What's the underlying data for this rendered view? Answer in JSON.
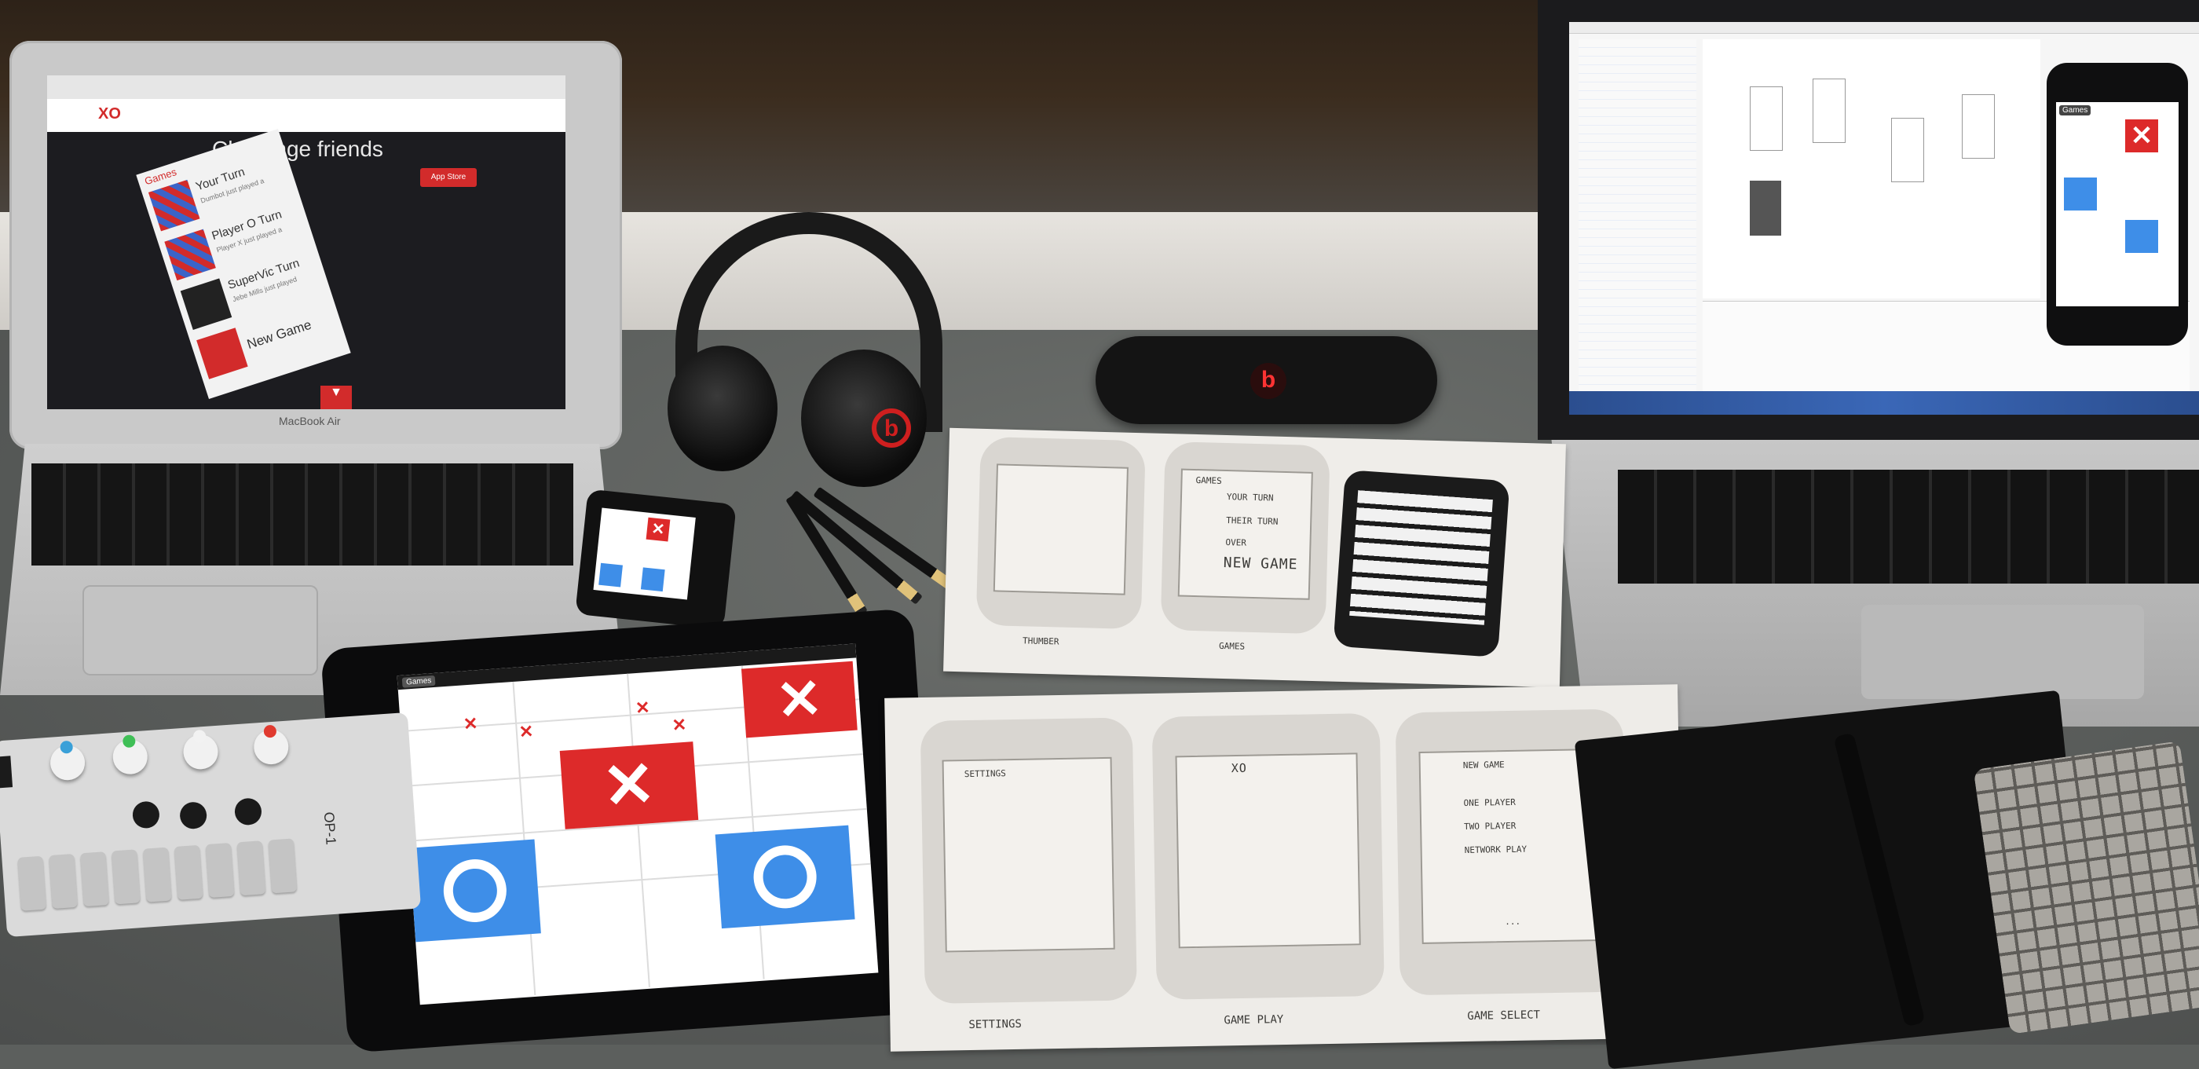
{
  "macbook_air": {
    "brand": "MacBook Air",
    "site": {
      "logo": "XO",
      "headline": "Challenge friends",
      "card_header": "Games",
      "rows": [
        {
          "title": "Your Turn",
          "subtitle": "Dumbot just played a"
        },
        {
          "title": "Player O Turn",
          "subtitle": "Player X just played a"
        },
        {
          "title": "SuperVic Turn",
          "subtitle": "Jebe Mills just played"
        },
        {
          "title": "New Game",
          "subtitle": ""
        }
      ],
      "app_store_badge": "App Store",
      "scroll_arrow": "▼"
    }
  },
  "macbook_pro": {
    "phone_games_button": "Games"
  },
  "ipad": {
    "games_button": "Games"
  },
  "sketch_sheet_top": {
    "labels": [
      "THUMBER",
      "GAMES"
    ],
    "games_screen_items": [
      "GAMES",
      "YOUR TURN",
      "THEIR TURN",
      "OVER",
      "NEW GAME"
    ]
  },
  "sketch_sheet_bottom": {
    "screens": [
      "SETTINGS",
      "GAME PLAY",
      "GAME SELECT"
    ],
    "settings_header": "SETTINGS",
    "gameplay_header": "XO",
    "game_select_header": "NEW GAME",
    "game_select_items": [
      "ONE PLAYER",
      "TWO PLAYER",
      "NETWORK PLAY",
      "..."
    ]
  },
  "synth": {
    "brand": "OP-1",
    "knob_colors": [
      "#3aa0d8",
      "#3fbf56",
      "#f2f2f2",
      "#e03a2f"
    ]
  },
  "speaker": {
    "logo": "b"
  },
  "headphones": {
    "logo": "b"
  }
}
